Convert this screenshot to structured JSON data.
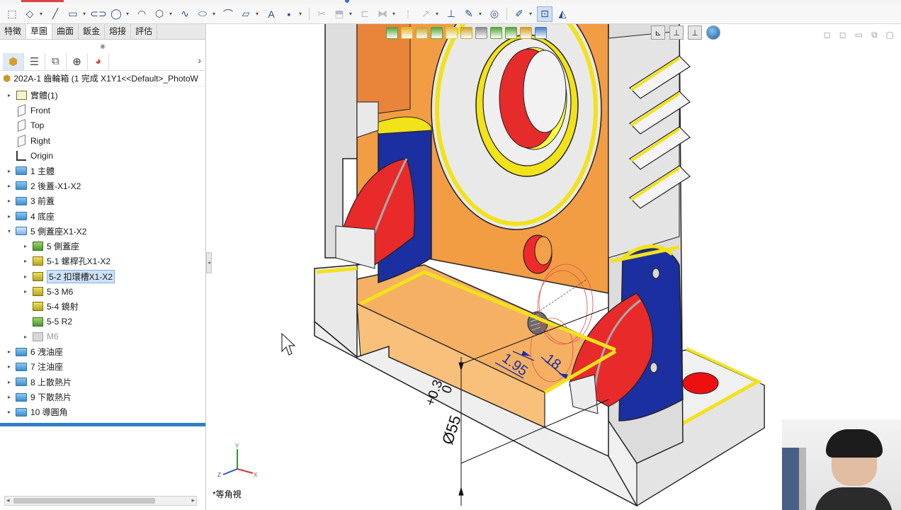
{
  "toolbar": {
    "icons": [
      "sketch-icon",
      "smart-dimension-icon",
      "line-icon",
      "rectangle-icon",
      "slot-icon",
      "circle-icon",
      "arc-icon",
      "polygon-icon",
      "spline-icon",
      "ellipse-icon",
      "fillet-icon",
      "plane-icon",
      "text-icon",
      "point-icon",
      "trim-icon",
      "convert-entities-icon",
      "offset-icon",
      "mirror-icon",
      "linear-pattern-icon",
      "move-icon",
      "relations-icon",
      "repair-icon",
      "quick-snaps-icon",
      "rapid-sketch-icon",
      "instant2d-icon",
      "shaded-sketch-icon"
    ]
  },
  "command_manager": {
    "tabs": [
      "特徵",
      "草圖",
      "曲面",
      "鈑金",
      "熔接",
      "評估"
    ],
    "active_tab": "草圖"
  },
  "feature_tree": {
    "root_label": "202A-1 齒輪箱  (1 完成 X1Y1<<Default>_PhotoW",
    "items": [
      {
        "label": "實體(1)",
        "icon": "solid-bodies-icon",
        "level": 0,
        "expand": "▸"
      },
      {
        "label": "Front",
        "icon": "plane-icon",
        "level": 0,
        "expand": ""
      },
      {
        "label": "Top",
        "icon": "plane-icon",
        "level": 0,
        "expand": ""
      },
      {
        "label": "Right",
        "icon": "plane-icon",
        "level": 0,
        "expand": ""
      },
      {
        "label": "Origin",
        "icon": "origin-icon",
        "level": 0,
        "expand": ""
      },
      {
        "label": "1 主體",
        "icon": "folder-icon",
        "level": 0,
        "expand": "▸"
      },
      {
        "label": "2 後蓋-X1-X2",
        "icon": "folder-icon",
        "level": 0,
        "expand": "▸"
      },
      {
        "label": "3 前蓋",
        "icon": "folder-icon",
        "level": 0,
        "expand": "▸"
      },
      {
        "label": "4 底座",
        "icon": "folder-icon",
        "level": 0,
        "expand": "▸"
      },
      {
        "label": "5 側蓋座X1-X2",
        "icon": "folder-open-icon",
        "level": 0,
        "expand": "▾"
      },
      {
        "label": "5 側蓋座",
        "icon": "extrude-icon",
        "level": 1,
        "expand": "▸"
      },
      {
        "label": "5-1 螺桿孔X1-X2",
        "icon": "cut-extrude-icon",
        "level": 1,
        "expand": "▸"
      },
      {
        "label": "5-2 扣環槽X1-X2",
        "icon": "cut-extrude-icon",
        "level": 1,
        "expand": "▸",
        "selected": true
      },
      {
        "label": "5-3 M6",
        "icon": "hole-wizard-icon",
        "level": 1,
        "expand": "▸"
      },
      {
        "label": "5-4 鏡射",
        "icon": "mirror-icon",
        "level": 1,
        "expand": ""
      },
      {
        "label": "5-5 R2",
        "icon": "fillet-icon",
        "level": 1,
        "expand": ""
      },
      {
        "label": "M6",
        "icon": "hole-wizard-icon",
        "level": 1,
        "expand": "▸",
        "dim": true
      },
      {
        "label": "6 洩油座",
        "icon": "folder-icon",
        "level": 0,
        "expand": "▸"
      },
      {
        "label": "7 注油座",
        "icon": "folder-icon",
        "level": 0,
        "expand": "▸"
      },
      {
        "label": "8 上散熱片",
        "icon": "folder-icon",
        "level": 0,
        "expand": "▸"
      },
      {
        "label": "9 下散熱片",
        "icon": "folder-icon",
        "level": 0,
        "expand": "▸"
      },
      {
        "label": "10 導圓角",
        "icon": "folder-icon",
        "level": 0,
        "expand": "▸"
      }
    ]
  },
  "viewport": {
    "view_name": "*等角視",
    "dimensions": {
      "slot_depth": "1.95",
      "slot_width": "18",
      "tolerance_upper": "+0.3",
      "tolerance_lower": "0",
      "diameter": "Ø55"
    },
    "triad_labels": {
      "x": "X",
      "y": "Y",
      "z": "Z"
    }
  },
  "colors": {
    "body_orange": "#f2a04a",
    "face_red": "#e23a3a",
    "face_blue": "#1c34a8",
    "edge_yellow": "#f2e21a",
    "dimension_blue": "#1b2ea8",
    "selection_blue": "#cde1f7"
  }
}
